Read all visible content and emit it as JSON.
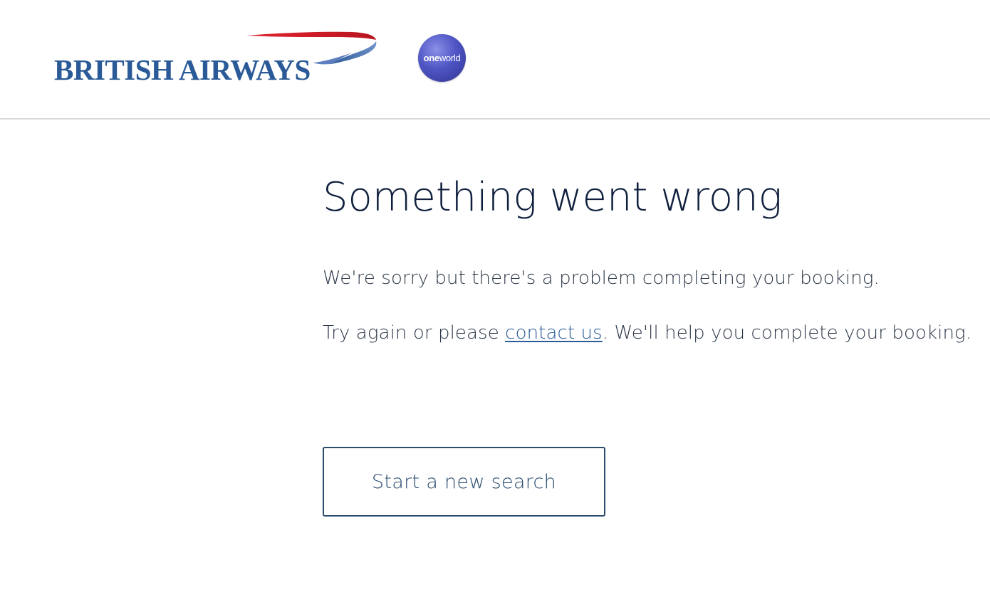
{
  "header": {
    "brand_name": "BRITISH AIRWAYS",
    "alliance_logo_bold": "one",
    "alliance_logo_regular": "world"
  },
  "error": {
    "title": "Something went wrong",
    "message_line1": "We're sorry but there's a problem completing your booking.",
    "message_line2_prefix": "Try again or please ",
    "contact_link_label": "contact us",
    "message_line2_suffix": ". We'll help you complete your booking."
  },
  "actions": {
    "new_search_label": "Start a new search"
  },
  "colors": {
    "brand_blue": "#2a5a97",
    "brand_red": "#d2202f",
    "title_navy": "#0f1f3d",
    "divider_grey": "#d9d9d9"
  }
}
